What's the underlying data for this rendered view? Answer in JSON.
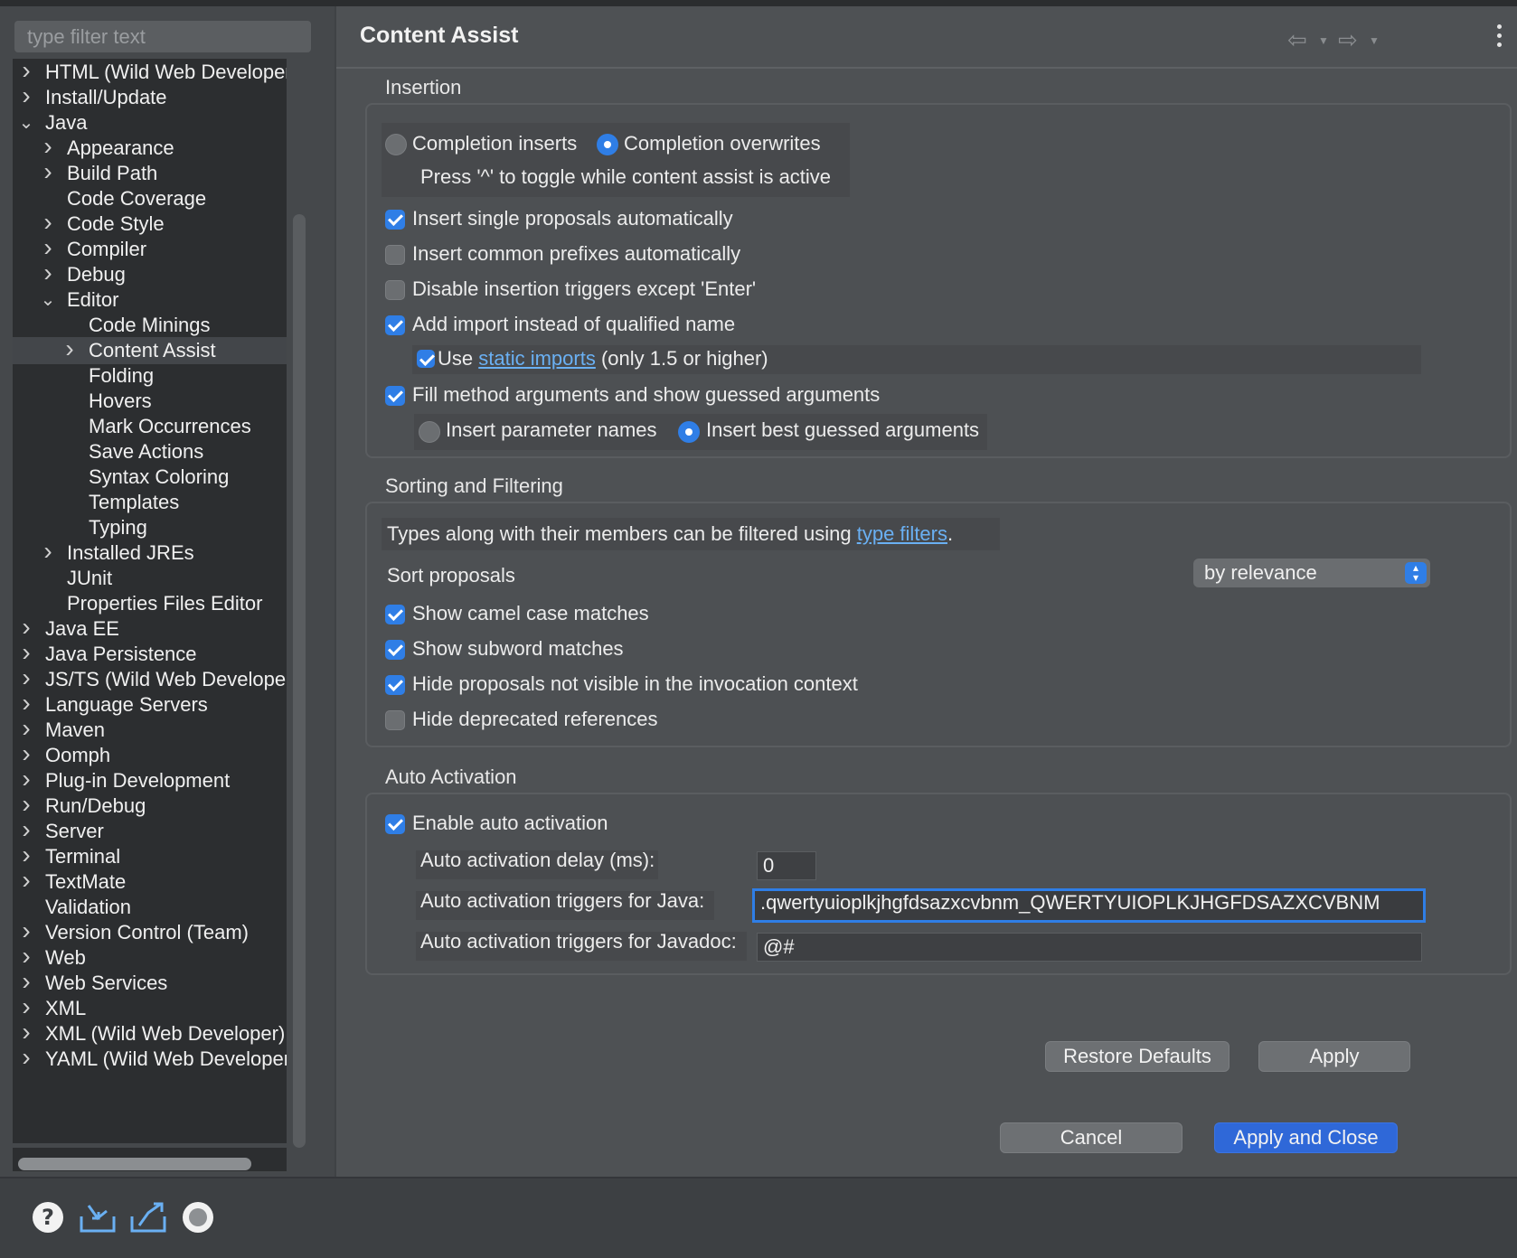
{
  "filter": {
    "placeholder": "type filter text"
  },
  "tree": {
    "items": [
      {
        "label": "HTML (Wild Web Developer)",
        "chevron": "right"
      },
      {
        "label": "Install/Update",
        "chevron": "right"
      },
      {
        "label": "Java",
        "chevron": "down"
      },
      {
        "label": "Appearance",
        "chevron": "right"
      },
      {
        "label": "Build Path",
        "chevron": "right"
      },
      {
        "label": "Code Coverage",
        "chevron": ""
      },
      {
        "label": "Code Style",
        "chevron": "right"
      },
      {
        "label": "Compiler",
        "chevron": "right"
      },
      {
        "label": "Debug",
        "chevron": "right"
      },
      {
        "label": "Editor",
        "chevron": "down"
      },
      {
        "label": "Code Minings",
        "chevron": ""
      },
      {
        "label": "Content Assist",
        "chevron": "right"
      },
      {
        "label": "Folding",
        "chevron": ""
      },
      {
        "label": "Hovers",
        "chevron": ""
      },
      {
        "label": "Mark Occurrences",
        "chevron": ""
      },
      {
        "label": "Save Actions",
        "chevron": ""
      },
      {
        "label": "Syntax Coloring",
        "chevron": ""
      },
      {
        "label": "Templates",
        "chevron": ""
      },
      {
        "label": "Typing",
        "chevron": ""
      },
      {
        "label": "Installed JREs",
        "chevron": "right"
      },
      {
        "label": "JUnit",
        "chevron": ""
      },
      {
        "label": "Properties Files Editor",
        "chevron": ""
      },
      {
        "label": "Java EE",
        "chevron": "right"
      },
      {
        "label": "Java Persistence",
        "chevron": "right"
      },
      {
        "label": "JS/TS (Wild Web Developer)",
        "chevron": "right"
      },
      {
        "label": "Language Servers",
        "chevron": "right"
      },
      {
        "label": "Maven",
        "chevron": "right"
      },
      {
        "label": "Oomph",
        "chevron": "right"
      },
      {
        "label": "Plug-in Development",
        "chevron": "right"
      },
      {
        "label": "Run/Debug",
        "chevron": "right"
      },
      {
        "label": "Server",
        "chevron": "right"
      },
      {
        "label": "Terminal",
        "chevron": "right"
      },
      {
        "label": "TextMate",
        "chevron": "right"
      },
      {
        "label": "Validation",
        "chevron": ""
      },
      {
        "label": "Version Control (Team)",
        "chevron": "right"
      },
      {
        "label": "Web",
        "chevron": "right"
      },
      {
        "label": "Web Services",
        "chevron": "right"
      },
      {
        "label": "XML",
        "chevron": "right"
      },
      {
        "label": "XML (Wild Web Developer)",
        "chevron": "right"
      },
      {
        "label": "YAML (Wild Web Developer)",
        "chevron": "right"
      }
    ],
    "selected": "Content Assist"
  },
  "page": {
    "title": "Content Assist"
  },
  "insertion": {
    "title": "Insertion",
    "completion_inserts": "Completion inserts",
    "completion_overwrites": "Completion overwrites",
    "completion_mode": "overwrites",
    "toggle_hint": "Press '^' to toggle while content assist is active",
    "single_proposals": {
      "label": "Insert single proposals automatically",
      "checked": true
    },
    "common_prefixes": {
      "label": "Insert common prefixes automatically",
      "checked": false
    },
    "disable_triggers": {
      "label": "Disable insertion triggers except 'Enter'",
      "checked": false
    },
    "add_import": {
      "label": "Add import instead of qualified name",
      "checked": true
    },
    "static_imports": {
      "prefix": "Use",
      "link": "static imports",
      "suffix": "(only 1.5 or higher)",
      "checked": true
    },
    "fill_args": {
      "label": "Fill method arguments and show guessed arguments",
      "checked": true
    },
    "param_names": "Insert parameter names",
    "best_guessed": "Insert best guessed arguments",
    "args_mode": "best_guessed"
  },
  "sorting": {
    "title": "Sorting and Filtering",
    "filter_text": "Types along with their members can be filtered using",
    "filter_link": "type filters",
    "filter_suffix": ".",
    "sort_label": "Sort proposals",
    "sort_value": "by relevance",
    "camel_case": {
      "label": "Show camel case matches",
      "checked": true
    },
    "subword": {
      "label": "Show subword matches",
      "checked": true
    },
    "hide_not_visible": {
      "label": "Hide proposals not visible in the invocation context",
      "checked": true
    },
    "hide_deprecated": {
      "label": "Hide deprecated references",
      "checked": false
    }
  },
  "auto_activation": {
    "title": "Auto Activation",
    "enable": {
      "label": "Enable auto activation",
      "checked": true
    },
    "delay_label": "Auto activation delay (ms):",
    "delay_value": "0",
    "java_label": "Auto activation triggers for Java:",
    "java_value": ".qwertyuioplkjhgfdsazxcvbnm_QWERTYUIOPLKJHGFDSAZXCVBNM",
    "javadoc_label": "Auto activation triggers for Javadoc:",
    "javadoc_value": "@#"
  },
  "buttons": {
    "restore_defaults": "Restore Defaults",
    "apply": "Apply",
    "cancel": "Cancel",
    "apply_and_close": "Apply and Close"
  },
  "footer_icons": [
    "help-icon",
    "import-icon",
    "export-icon",
    "record-icon"
  ],
  "colors": {
    "accent": "#2f7ee6",
    "link": "#6ab0f3",
    "primary_button": "#2f68d8"
  }
}
